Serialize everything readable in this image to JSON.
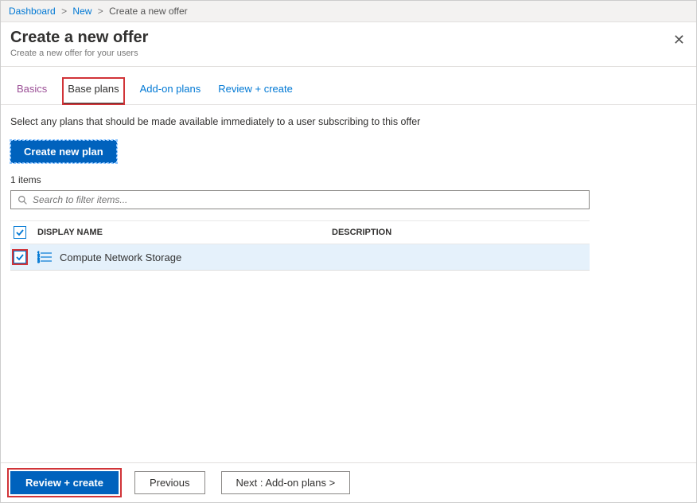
{
  "breadcrumb": {
    "dashboard": "Dashboard",
    "new": "New",
    "current": "Create a new offer"
  },
  "header": {
    "title": "Create a new offer",
    "subtitle": "Create a new offer for your users"
  },
  "tabs": {
    "basics": "Basics",
    "base_plans": "Base plans",
    "addon_plans": "Add-on plans",
    "review_create": "Review + create"
  },
  "body": {
    "description": "Select any plans that should be made available immediately to a user subscribing to this offer",
    "create_plan_label": "Create new plan",
    "item_count": "1 items",
    "search_placeholder": "Search to filter items..."
  },
  "table": {
    "header_display": "DISPLAY NAME",
    "header_description": "DESCRIPTION",
    "rows": [
      {
        "name": "Compute Network Storage",
        "description": ""
      }
    ]
  },
  "footer": {
    "review_create": "Review + create",
    "previous": "Previous",
    "next": "Next : Add-on plans >"
  }
}
